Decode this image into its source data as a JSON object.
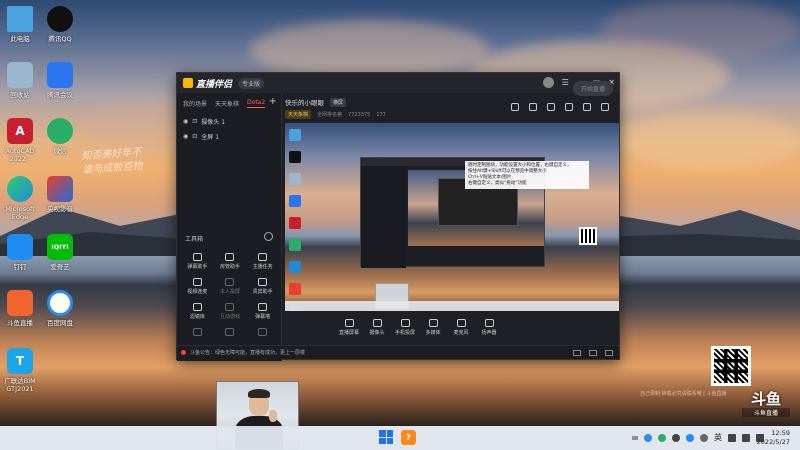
{
  "desktop_icons": [
    {
      "label": "此电脑",
      "icon": "this-pc-icon",
      "color": "#4aa3df",
      "glyph": ""
    },
    {
      "label": "腾讯QQ",
      "icon": "qq-icon",
      "color": "#111111",
      "glyph": ""
    },
    {
      "label": "回收站",
      "icon": "recycle-bin-icon",
      "color": "#9ab7cf",
      "glyph": ""
    },
    {
      "label": "腾讯会议",
      "icon": "tencent-meeting-icon",
      "color": "#2a74f0",
      "glyph": ""
    },
    {
      "label": "AutoCAD\n2022 -",
      "icon": "autocad-icon",
      "color": "#c8202f",
      "glyph": "A"
    },
    {
      "label": "微信",
      "icon": "wechat-icon",
      "color": "#2aae67",
      "glyph": ""
    },
    {
      "label": "Microsoft\nEdge",
      "icon": "edge-icon",
      "color": "#1f8ad9",
      "glyph": ""
    },
    {
      "label": "央视影音",
      "icon": "cctv-icon",
      "color": "#e8402b",
      "glyph": ""
    },
    {
      "label": "钉钉",
      "icon": "dingtalk-icon",
      "color": "#1e8cf3",
      "glyph": ""
    },
    {
      "label": "爱奇艺",
      "icon": "iqiyi-icon",
      "color": "#00be06",
      "glyph": "iQIYI"
    },
    {
      "label": "斗鱼直播",
      "icon": "douyu-icon",
      "color": "#f0652d",
      "glyph": ""
    },
    {
      "label": "百度网盘",
      "icon": "baidu-netdisk-icon",
      "color": "#ffffff",
      "glyph": ""
    },
    {
      "label": "广联达BIM\nGTJ2021",
      "icon": "glodon-icon",
      "color": "#1aa5e8",
      "glyph": "T"
    }
  ],
  "calligraphy": "知否美好年不\n谁与成败百物",
  "app": {
    "logo_text": "直播伴侣",
    "edition": "专业版",
    "scene_tabs": [
      "我的场景",
      "天天象棋",
      "Dota2"
    ],
    "active_scene": "Dota2",
    "add_label": "+",
    "sources": [
      {
        "label": "摄像头 1",
        "icon": "camera-icon"
      },
      {
        "label": "全屏 1",
        "icon": "screen-icon"
      }
    ],
    "tools_header": "工具箱",
    "tools": [
      {
        "label": "弹幕助手",
        "dim": false
      },
      {
        "label": "房管助手",
        "dim": false
      },
      {
        "label": "主播任务",
        "dim": false
      },
      {
        "label": "视频连麦",
        "dim": false
      },
      {
        "label": "本人投屏",
        "dim": true
      },
      {
        "label": "贵宾助手",
        "dim": false
      },
      {
        "label": "滤镜库",
        "dim": false
      },
      {
        "label": "互动游戏",
        "dim": true
      },
      {
        "label": "弹幕墙",
        "dim": false
      },
      {
        "label": "",
        "dim": true
      },
      {
        "label": "",
        "dim": true
      },
      {
        "label": "",
        "dim": true
      }
    ],
    "room_title": "快乐的小眼眼",
    "room_tag": "横屏",
    "room_chip": "天天象棋",
    "room_sub": [
      "全网排名第",
      "7723375",
      "177"
    ],
    "note_text": "随时定制图块，功能设置大小和位置，右键自定义，\n按住Alt键+Shift可以在预览中调整大小\nCtrl+V粘贴文本/图片\n右键自定义，类似“拖动”功能",
    "bottom_toolbar": [
      {
        "label": "直播屏幕",
        "icon": "screen-share-icon"
      },
      {
        "label": "摄像头",
        "icon": "camera-icon"
      },
      {
        "label": "手机投屏",
        "icon": "phone-cast-icon"
      },
      {
        "label": "多媒体",
        "icon": "media-icon"
      },
      {
        "label": "麦克风",
        "icon": "mic-icon"
      },
      {
        "label": "扬声器",
        "icon": "speaker-icon"
      }
    ],
    "start_button": "开始直播",
    "status_text": "斗鱼公告：绿色无障可能，直播有成功，更上一层楼"
  },
  "watermark": "自己录制·转载必究请联系哦 | 斗鱼直播",
  "brand_mark": "斗鱼",
  "brand_sub": "斗鱼直播",
  "taskbar": {
    "app_glyph": "?",
    "tray_lang": "英",
    "time": "12:59",
    "date": "2022/5/27"
  }
}
